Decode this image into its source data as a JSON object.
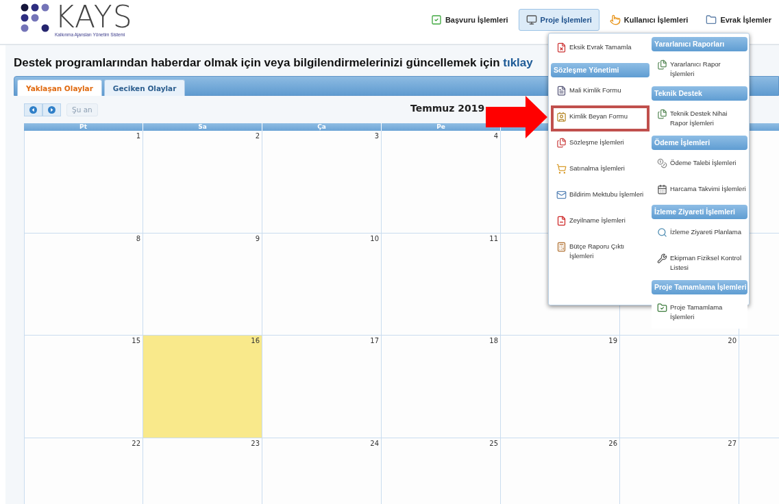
{
  "header": {
    "logo": {
      "name": "KAYS",
      "subtitle": "Kalkınma Ajansları Yönetim Sistemi"
    },
    "nav": [
      {
        "label": "Başvuru İşlemleri",
        "selected": false
      },
      {
        "label": "Proje İşlemleri",
        "selected": true
      },
      {
        "label": "Kullanıcı İşlemleri",
        "selected": false
      },
      {
        "label": "Evrak İşlemler",
        "selected": false
      }
    ]
  },
  "notice": {
    "text": "Destek programlarından haberdar olmak için veya bilgilendirmelerinizi güncellemek için",
    "link": "tıklay"
  },
  "tabs": [
    {
      "label": "Yaklaşan Olaylar",
      "selected": true
    },
    {
      "label": "Geciken Olaylar",
      "selected": false
    }
  ],
  "calendar": {
    "today_button": {
      "label": "Şu an",
      "disabled": true
    },
    "title": "Temmuz 2019",
    "weekdays": [
      "Pt",
      "Sa",
      "Ça",
      "Pe"
    ],
    "weeks": [
      [
        {
          "day": "1",
          "today": false
        },
        {
          "day": "2",
          "today": false
        },
        {
          "day": "3",
          "today": false
        },
        {
          "day": "4",
          "today": false
        }
      ],
      [
        {
          "day": "8",
          "today": false
        },
        {
          "day": "9",
          "today": false
        },
        {
          "day": "10",
          "today": false
        },
        {
          "day": "11",
          "today": false
        }
      ],
      [
        {
          "day": "15",
          "today": false
        },
        {
          "day": "16",
          "today": true
        },
        {
          "day": "17",
          "today": false
        },
        {
          "day": "18",
          "today": false
        },
        {
          "day": "19",
          "today": false
        },
        {
          "day": "20",
          "today": false
        }
      ],
      [
        {
          "day": "22",
          "today": false
        },
        {
          "day": "23",
          "today": false
        },
        {
          "day": "24",
          "today": false
        },
        {
          "day": "25",
          "today": false
        },
        {
          "day": "26",
          "today": false
        },
        {
          "day": "27",
          "today": false
        }
      ]
    ]
  },
  "dropdown": {
    "columns": [
      [
        {
          "kind": "item",
          "label": "Eksik Evrak Tamamla",
          "highlighted": false
        },
        {
          "kind": "header",
          "label": "Sözleşme Yönetimi"
        },
        {
          "kind": "item",
          "label": "Mali Kimlik Formu",
          "highlighted": false
        },
        {
          "kind": "item",
          "label": "Kimlik Beyan Formu",
          "highlighted": true
        },
        {
          "kind": "item",
          "label": "Sözleşme İşlemleri",
          "highlighted": false
        },
        {
          "kind": "item",
          "label": "Satınalma İşlemleri",
          "highlighted": false
        },
        {
          "kind": "item",
          "label": "Bildirim Mektubu İşlemleri",
          "highlighted": false
        },
        {
          "kind": "item",
          "label": "Zeyilname İşlemleri",
          "highlighted": false
        },
        {
          "kind": "item",
          "label": "Bütçe Raporu Çıktı İşlemleri",
          "highlighted": false
        }
      ],
      [
        {
          "kind": "header",
          "label": "Yararlanıcı Raporları"
        },
        {
          "kind": "item",
          "label": "Yararlanıcı Rapor İşlemleri",
          "highlighted": false
        },
        {
          "kind": "header",
          "label": "Teknik Destek"
        },
        {
          "kind": "item",
          "label": "Teknik Destek Nihai Rapor İşlemleri",
          "highlighted": false
        },
        {
          "kind": "header",
          "label": "Ödeme İşlemleri"
        },
        {
          "kind": "item",
          "label": "Ödeme Talebi İşlemleri",
          "highlighted": false
        },
        {
          "kind": "item",
          "label": "Harcama Takvimi İşlemleri",
          "highlighted": false
        },
        {
          "kind": "header",
          "label": "İzleme Ziyareti İşlemleri"
        },
        {
          "kind": "item",
          "label": "İzleme Ziyareti Planlama",
          "highlighted": false
        },
        {
          "kind": "item",
          "label": "Ekipman Fiziksel Kontrol Listesi",
          "highlighted": false
        },
        {
          "kind": "header",
          "label": "Proje Tamamlama İşlemleri"
        },
        {
          "kind": "item",
          "label": "Proje Tamamlama İşlemleri",
          "highlighted": false
        }
      ]
    ]
  }
}
